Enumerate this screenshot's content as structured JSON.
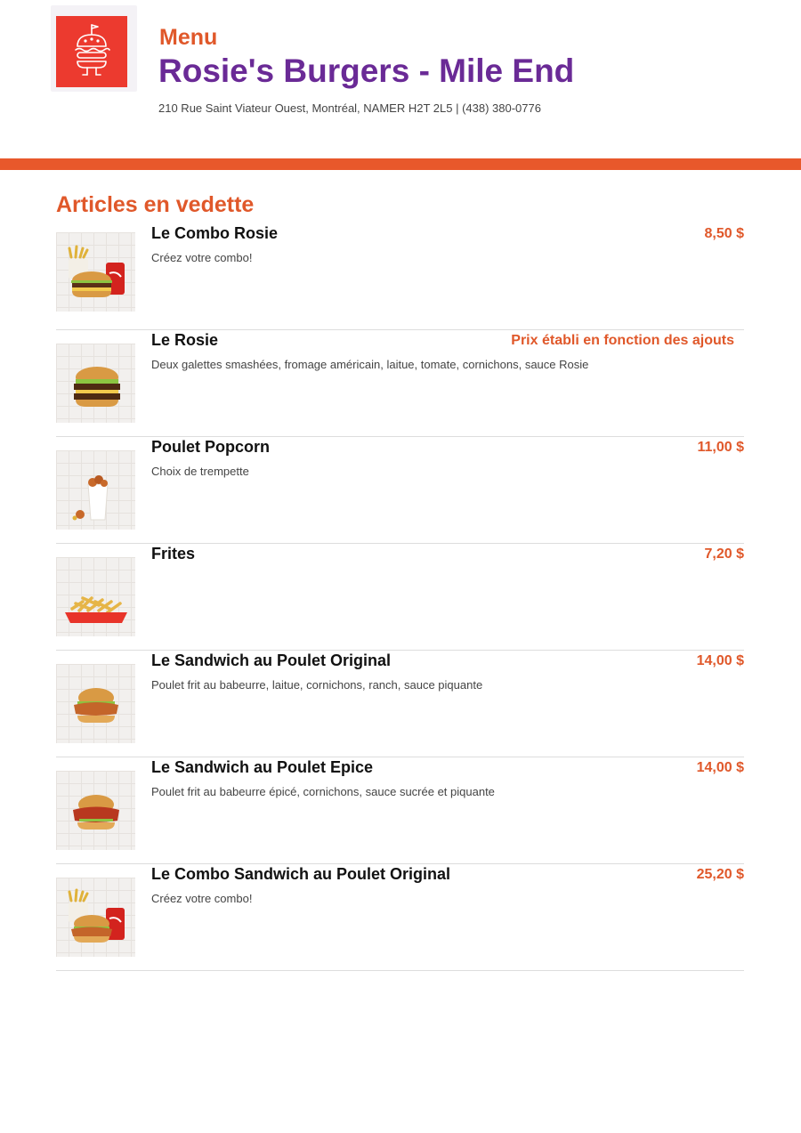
{
  "header": {
    "logo_icon": "burger-mascot-icon",
    "menu_label": "Menu",
    "restaurant_name": "Rosie's Burgers - Mile End",
    "address": "210 Rue Saint Viateur Ouest, Montréal, NAMER H2T 2L5 | (438) 380-0776"
  },
  "colors": {
    "accent": "#e0582a",
    "brand_purple": "#6a2a96",
    "logo_red": "#ec3a2f"
  },
  "section": {
    "title": "Articles en vedette"
  },
  "items": [
    {
      "name": "Le Combo Rosie",
      "description": "Créez votre combo!",
      "price": "8,50 $",
      "image": "burger-combo-photo"
    },
    {
      "name": "Le Rosie",
      "description": "Deux galettes smashées, fromage américain, laitue, tomate, cornichons, sauce Rosie",
      "price": "Prix établi en fonction des ajouts",
      "image": "burger-photo"
    },
    {
      "name": "Poulet Popcorn",
      "description": "Choix de trempette",
      "price": "11,00 $",
      "image": "popcorn-chicken-photo"
    },
    {
      "name": "Frites",
      "description": "",
      "price": "7,20 $",
      "image": "fries-photo"
    },
    {
      "name": "Le Sandwich au Poulet Original",
      "description": "Poulet frit au babeurre, laitue, cornichons, ranch, sauce piquante",
      "price": "14,00 $",
      "image": "chicken-sandwich-photo"
    },
    {
      "name": "Le Sandwich au Poulet Epice",
      "description": "Poulet frit au babeurre épicé, cornichons, sauce sucrée et piquante",
      "price": "14,00 $",
      "image": "spicy-chicken-sandwich-photo"
    },
    {
      "name": "Le Combo Sandwich au Poulet Original",
      "description": "Créez votre combo!",
      "price": "25,20 $",
      "image": "chicken-sandwich-combo-photo"
    }
  ]
}
